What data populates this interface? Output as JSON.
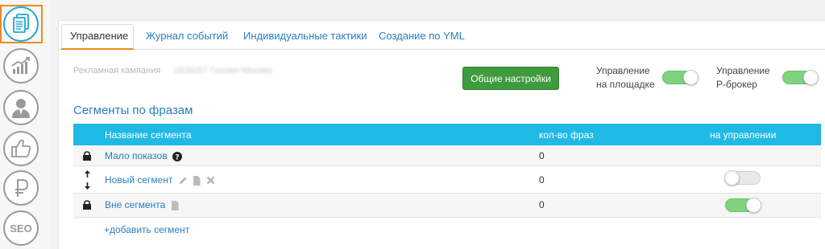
{
  "rail": {
    "items": [
      {
        "icon": "documents-icon",
        "active": true
      },
      {
        "icon": "chart-growth-icon"
      },
      {
        "icon": "user-icon"
      },
      {
        "icon": "thumbs-up-icon"
      },
      {
        "icon": "ruble-icon"
      },
      {
        "icon": "seo-icon",
        "label": "SEO"
      }
    ]
  },
  "tabs": [
    {
      "label": "Управление",
      "active": true
    },
    {
      "label": "Журнал событий"
    },
    {
      "label": "Индивидуальные тактики"
    },
    {
      "label": "Создание по YML"
    }
  ],
  "campaign": {
    "label": "Рекламная кампания",
    "name": "1936057 Гиалин Москва"
  },
  "settings_button": "Общие настройки",
  "toggles": {
    "platform": {
      "line1": "Управление",
      "line2": "на площадке",
      "on": true
    },
    "broker": {
      "line1": "Управление",
      "line2": "Р-брокер",
      "on": true
    }
  },
  "section_title": "Сегменты по фразам",
  "table": {
    "headers": {
      "name": "Название сегмента",
      "count": "кол-во фраз",
      "managed": "на управлении"
    },
    "rows": [
      {
        "name": "Мало показов",
        "count": "0",
        "icon": "lock-icon",
        "extra": "help-icon"
      },
      {
        "name": "Новый сегмент",
        "count": "0",
        "icon": "move-arrows-icon",
        "extra": "edit-copy-delete-icons",
        "managed": false
      },
      {
        "name": "Вне сегмента",
        "count": "0",
        "icon": "lock-icon",
        "extra": "copy-icon",
        "managed": true
      }
    ],
    "add_link": "+добавить сегмент"
  },
  "colors": {
    "accent_orange": "#f08a1e",
    "header_cyan": "#1fb9e6",
    "link_blue": "#2a7dc1",
    "button_green": "#3e9b3e",
    "toggle_on": "#7fd37f"
  }
}
